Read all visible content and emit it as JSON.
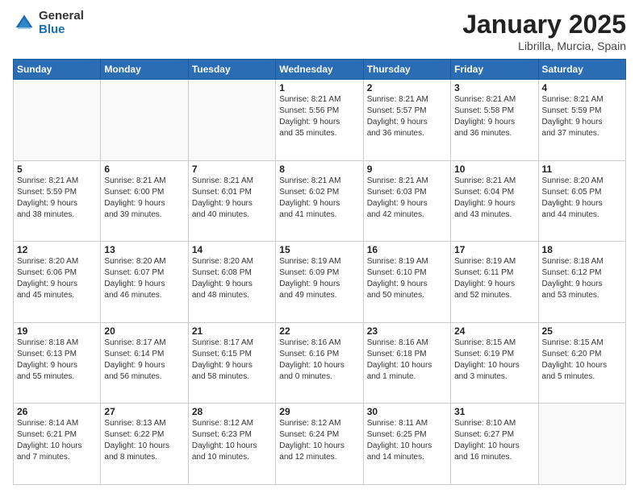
{
  "header": {
    "logo_general": "General",
    "logo_blue": "Blue",
    "title": "January 2025",
    "subtitle": "Librilla, Murcia, Spain"
  },
  "weekdays": [
    "Sunday",
    "Monday",
    "Tuesday",
    "Wednesday",
    "Thursday",
    "Friday",
    "Saturday"
  ],
  "weeks": [
    [
      {
        "day": "",
        "info": ""
      },
      {
        "day": "",
        "info": ""
      },
      {
        "day": "",
        "info": ""
      },
      {
        "day": "1",
        "info": "Sunrise: 8:21 AM\nSunset: 5:56 PM\nDaylight: 9 hours\nand 35 minutes."
      },
      {
        "day": "2",
        "info": "Sunrise: 8:21 AM\nSunset: 5:57 PM\nDaylight: 9 hours\nand 36 minutes."
      },
      {
        "day": "3",
        "info": "Sunrise: 8:21 AM\nSunset: 5:58 PM\nDaylight: 9 hours\nand 36 minutes."
      },
      {
        "day": "4",
        "info": "Sunrise: 8:21 AM\nSunset: 5:59 PM\nDaylight: 9 hours\nand 37 minutes."
      }
    ],
    [
      {
        "day": "5",
        "info": "Sunrise: 8:21 AM\nSunset: 5:59 PM\nDaylight: 9 hours\nand 38 minutes."
      },
      {
        "day": "6",
        "info": "Sunrise: 8:21 AM\nSunset: 6:00 PM\nDaylight: 9 hours\nand 39 minutes."
      },
      {
        "day": "7",
        "info": "Sunrise: 8:21 AM\nSunset: 6:01 PM\nDaylight: 9 hours\nand 40 minutes."
      },
      {
        "day": "8",
        "info": "Sunrise: 8:21 AM\nSunset: 6:02 PM\nDaylight: 9 hours\nand 41 minutes."
      },
      {
        "day": "9",
        "info": "Sunrise: 8:21 AM\nSunset: 6:03 PM\nDaylight: 9 hours\nand 42 minutes."
      },
      {
        "day": "10",
        "info": "Sunrise: 8:21 AM\nSunset: 6:04 PM\nDaylight: 9 hours\nand 43 minutes."
      },
      {
        "day": "11",
        "info": "Sunrise: 8:20 AM\nSunset: 6:05 PM\nDaylight: 9 hours\nand 44 minutes."
      }
    ],
    [
      {
        "day": "12",
        "info": "Sunrise: 8:20 AM\nSunset: 6:06 PM\nDaylight: 9 hours\nand 45 minutes."
      },
      {
        "day": "13",
        "info": "Sunrise: 8:20 AM\nSunset: 6:07 PM\nDaylight: 9 hours\nand 46 minutes."
      },
      {
        "day": "14",
        "info": "Sunrise: 8:20 AM\nSunset: 6:08 PM\nDaylight: 9 hours\nand 48 minutes."
      },
      {
        "day": "15",
        "info": "Sunrise: 8:19 AM\nSunset: 6:09 PM\nDaylight: 9 hours\nand 49 minutes."
      },
      {
        "day": "16",
        "info": "Sunrise: 8:19 AM\nSunset: 6:10 PM\nDaylight: 9 hours\nand 50 minutes."
      },
      {
        "day": "17",
        "info": "Sunrise: 8:19 AM\nSunset: 6:11 PM\nDaylight: 9 hours\nand 52 minutes."
      },
      {
        "day": "18",
        "info": "Sunrise: 8:18 AM\nSunset: 6:12 PM\nDaylight: 9 hours\nand 53 minutes."
      }
    ],
    [
      {
        "day": "19",
        "info": "Sunrise: 8:18 AM\nSunset: 6:13 PM\nDaylight: 9 hours\nand 55 minutes."
      },
      {
        "day": "20",
        "info": "Sunrise: 8:17 AM\nSunset: 6:14 PM\nDaylight: 9 hours\nand 56 minutes."
      },
      {
        "day": "21",
        "info": "Sunrise: 8:17 AM\nSunset: 6:15 PM\nDaylight: 9 hours\nand 58 minutes."
      },
      {
        "day": "22",
        "info": "Sunrise: 8:16 AM\nSunset: 6:16 PM\nDaylight: 10 hours\nand 0 minutes."
      },
      {
        "day": "23",
        "info": "Sunrise: 8:16 AM\nSunset: 6:18 PM\nDaylight: 10 hours\nand 1 minute."
      },
      {
        "day": "24",
        "info": "Sunrise: 8:15 AM\nSunset: 6:19 PM\nDaylight: 10 hours\nand 3 minutes."
      },
      {
        "day": "25",
        "info": "Sunrise: 8:15 AM\nSunset: 6:20 PM\nDaylight: 10 hours\nand 5 minutes."
      }
    ],
    [
      {
        "day": "26",
        "info": "Sunrise: 8:14 AM\nSunset: 6:21 PM\nDaylight: 10 hours\nand 7 minutes."
      },
      {
        "day": "27",
        "info": "Sunrise: 8:13 AM\nSunset: 6:22 PM\nDaylight: 10 hours\nand 8 minutes."
      },
      {
        "day": "28",
        "info": "Sunrise: 8:12 AM\nSunset: 6:23 PM\nDaylight: 10 hours\nand 10 minutes."
      },
      {
        "day": "29",
        "info": "Sunrise: 8:12 AM\nSunset: 6:24 PM\nDaylight: 10 hours\nand 12 minutes."
      },
      {
        "day": "30",
        "info": "Sunrise: 8:11 AM\nSunset: 6:25 PM\nDaylight: 10 hours\nand 14 minutes."
      },
      {
        "day": "31",
        "info": "Sunrise: 8:10 AM\nSunset: 6:27 PM\nDaylight: 10 hours\nand 16 minutes."
      },
      {
        "day": "",
        "info": ""
      }
    ]
  ]
}
